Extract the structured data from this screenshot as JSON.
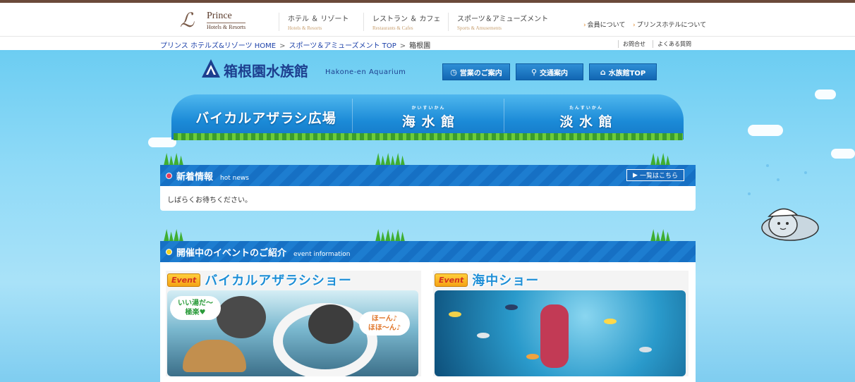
{
  "header": {
    "brand": {
      "name": "Prince",
      "sub": "Hotels & Resorts"
    },
    "nav": [
      {
        "ja": "ホテル ＆ リゾート",
        "en": "Hotels & Resorts"
      },
      {
        "ja": "レストラン ＆ カフェ",
        "en": "Restaurants & Cafes"
      },
      {
        "ja": "スポーツ＆アミューズメント",
        "en": "Sports & Amusements"
      }
    ],
    "util": [
      "会員について",
      "プリンスホテルについて"
    ]
  },
  "breadcrumb": {
    "items": [
      "プリンス ホテルズ&リゾーツ HOME",
      "スポーツ＆アミューズメント TOP",
      "箱根園"
    ],
    "sep": ">",
    "links": [
      "お問合せ",
      "よくある質問"
    ]
  },
  "aquarium": {
    "name": "箱根園水族館",
    "en": "Hakone-en Aquarium",
    "buttons": [
      "営業のご案内",
      "交通案内",
      "水族館TOP"
    ]
  },
  "tabs": [
    {
      "ruby": "",
      "label": "バイカルアザラシ広場"
    },
    {
      "ruby": "かいすいかん",
      "label": "海 水 館"
    },
    {
      "ruby": "たんすいかん",
      "label": "淡 水 館"
    }
  ],
  "news": {
    "title": "新着情報",
    "en": "hot news",
    "button": "一覧はこちら",
    "body": "しばらくお待ちください。"
  },
  "events": {
    "title": "開催中のイベントのご紹介",
    "en": "event information",
    "tag": "Event",
    "cards": [
      {
        "name": "バイカルアザラシショー",
        "bubble_left": "いい湯だ～\n極楽♥",
        "bubble_right": "ほーん♪\nほほ～ん♪"
      },
      {
        "name": "海中ショー"
      }
    ]
  },
  "colors": {
    "accent": "#1670c4",
    "brand": "#6b4a3a",
    "sky": "#8fdaf7"
  }
}
